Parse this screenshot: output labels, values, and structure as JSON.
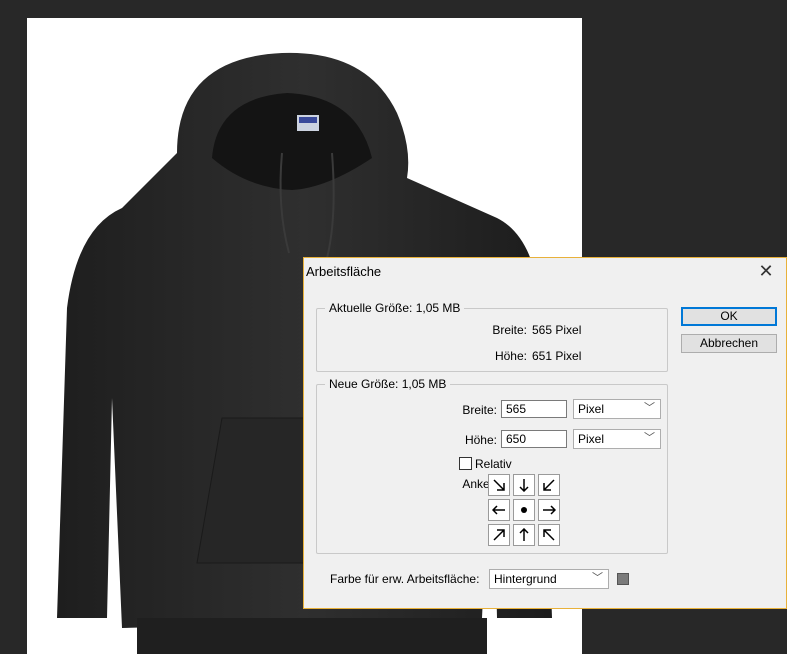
{
  "dialog": {
    "title": "Arbeitsfläche",
    "close_label": "✕",
    "current_size": {
      "legend": "Aktuelle Größe: 1,05 MB",
      "width_label": "Breite:",
      "width_value": "565 Pixel",
      "height_label": "Höhe:",
      "height_value": "651 Pixel"
    },
    "new_size": {
      "legend": "Neue Größe: 1,05 MB",
      "width_label": "Breite:",
      "width_value": "565",
      "width_unit": "Pixel",
      "height_label": "Höhe:",
      "height_value": "650",
      "height_unit": "Pixel",
      "relative_label": "Relativ",
      "relative_checked": false,
      "anchor_label": "Anker:",
      "anchor_selected": "center"
    },
    "canvas_color_label": "Farbe für erw. Arbeitsfläche:",
    "canvas_color_value": "Hintergrund",
    "canvas_color_swatch": "#7b7b7b",
    "ok_label": "OK",
    "cancel_label": "Abbrechen"
  },
  "colors": {
    "workspace": "#282828",
    "dialog_border": "#e8b13a",
    "default_button_border": "#0078d7"
  }
}
